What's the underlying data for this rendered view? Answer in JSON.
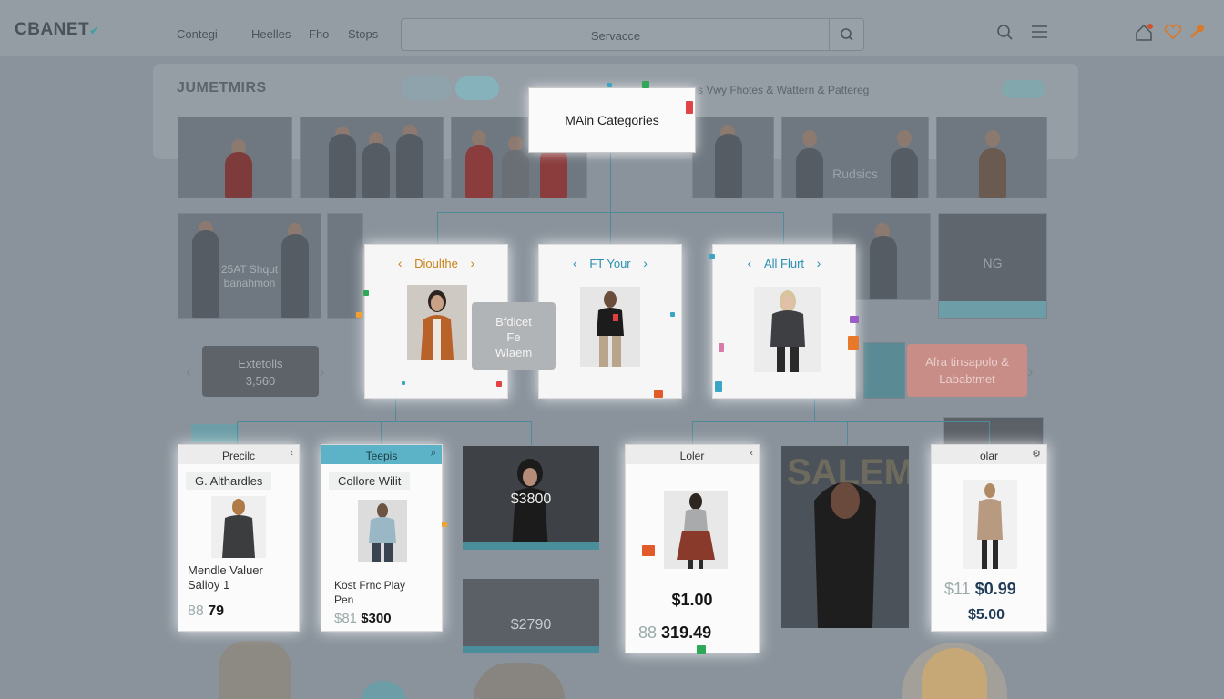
{
  "header": {
    "logo": "CBANET",
    "nav": [
      "Contegi",
      "Heelles",
      "Fho",
      "Stops"
    ],
    "search_placeholder": "Servacce"
  },
  "background": {
    "section_title": "JUMETMIRS",
    "subtitle": "s Vwy Fhotes & Wattern & Pattereg",
    "tile_captions": [
      "Rudsics",
      "25AT Shqut\nbanahmon",
      "NG"
    ],
    "left_card": [
      "Extetolls",
      "3,560"
    ],
    "right_card": [
      "Afra tinsapolo &",
      "Lababtmet"
    ]
  },
  "tree": {
    "root": "MAin Categories",
    "categories": [
      {
        "label": "Dioulthe"
      },
      {
        "label": "FT Your"
      },
      {
        "label": "All Flurt"
      }
    ],
    "tooltip": [
      "Bfdicet",
      "Fe",
      "Wlaem"
    ],
    "items": [
      {
        "head": "Precilc",
        "sub": "G. Althardles",
        "lines": [
          "Mendle Valuer",
          "Salioy 1"
        ],
        "price": "79",
        "price_ghost": "88"
      },
      {
        "head": "Teepis",
        "sub": "Collore Wilit",
        "lines": [
          "Kost Frnc Play",
          "Pen"
        ],
        "price": "$300",
        "price_ghost": "$81"
      },
      {
        "head": "Loler",
        "price": "$1.00",
        "price2": "319.49",
        "price2_ghost": "88"
      },
      {
        "head": "olar",
        "price": "$0.99",
        "price_ghost": "$11",
        "price2": "$5.00"
      }
    ],
    "photo_prices": [
      "$3800",
      "$2790"
    ]
  },
  "colors": {
    "accent_orange": "#c98318",
    "accent_blue": "#2b8fb0",
    "teal": "#5cb3c7",
    "connector": "#4e8a97"
  }
}
